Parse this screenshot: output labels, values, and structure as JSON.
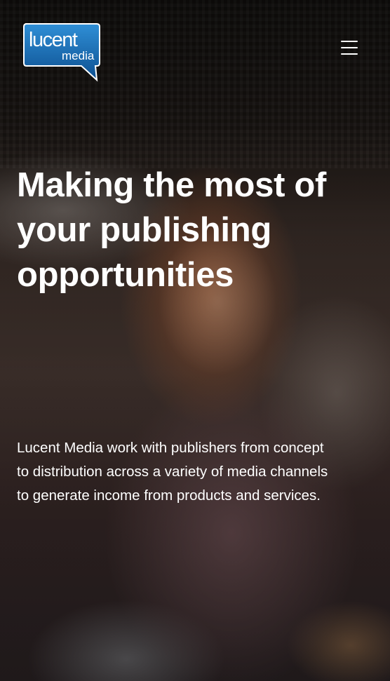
{
  "header": {
    "logo": {
      "word_top": "lucent",
      "word_bottom": "media",
      "brand_color": "#1a6fb8",
      "brand_color_dark": "#0d4f90"
    },
    "menu_icon": "hamburger-menu-icon"
  },
  "hero": {
    "headline_lines": [
      "Making the most of",
      "your publishing",
      "opportunities"
    ],
    "intro_lines": [
      "Lucent Media work with publishers from concept",
      "to distribution across a variety of media channels",
      "to generate income from products and services."
    ],
    "text_color": "#ffffff"
  }
}
